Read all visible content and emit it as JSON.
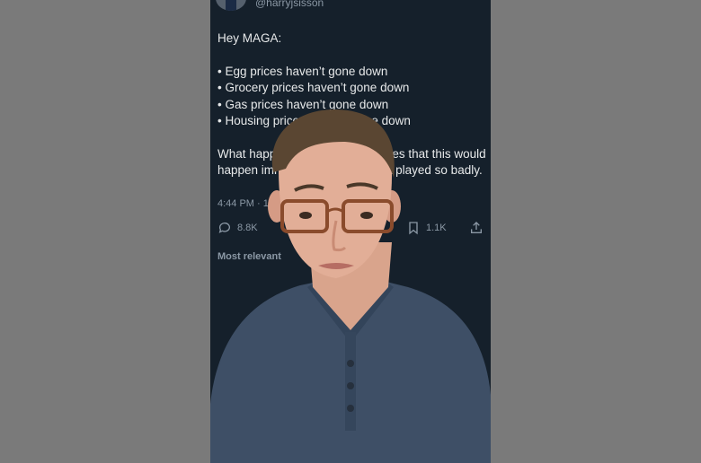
{
  "tweet": {
    "handle": "@harryjsisson",
    "greeting": "Hey MAGA:",
    "bullets": [
      "Egg prices haven’t gone down",
      "Grocery prices haven’t gone down",
      "Gas prices haven’t gone down",
      "Housing prices haven’t gone down"
    ],
    "closing": "What happened to all the promises that this would happen immediately? You all got played so badly.",
    "timestamp": "4:44 PM · 1/",
    "replies": "8.8K",
    "bookmarks": "1.1K",
    "sort_label": "Most relevant"
  },
  "colors": {
    "background": "#15202b",
    "text": "#e7e9ea",
    "muted": "#8b98a5",
    "page": "#7a7a7a"
  },
  "icons": [
    "reply-icon",
    "bookmark-icon",
    "share-icon",
    "mail-icon",
    "avatar"
  ]
}
